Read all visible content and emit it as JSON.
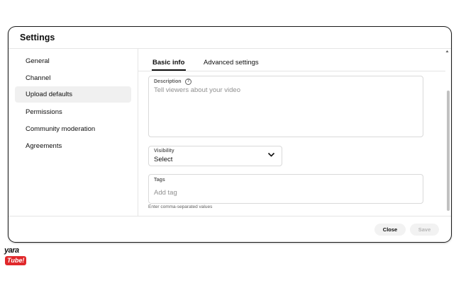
{
  "dialog": {
    "title": "Settings",
    "sidebar": {
      "items": [
        {
          "label": "General"
        },
        {
          "label": "Channel"
        },
        {
          "label": "Upload defaults",
          "active": true
        },
        {
          "label": "Permissions"
        },
        {
          "label": "Community moderation"
        },
        {
          "label": "Agreements"
        }
      ]
    },
    "tabs": [
      {
        "label": "Basic info",
        "active": true
      },
      {
        "label": "Advanced settings"
      }
    ],
    "description": {
      "label": "Description",
      "placeholder": "Tell viewers about your video",
      "help_icon": "?"
    },
    "visibility": {
      "label": "Visibility",
      "value": "Select"
    },
    "tags": {
      "label": "Tags",
      "placeholder": "Add tag",
      "hint": "Enter comma-separated values"
    },
    "footer": {
      "close_label": "Close",
      "save_label": "Save"
    }
  },
  "watermark": {
    "line1": "yara",
    "line2": "Tube!"
  },
  "colors": {
    "text": "#0f0f0f",
    "muted": "#606060",
    "active_nav_bg": "#f0f0f0",
    "border": "#d9d9d9",
    "logo_red": "#e0282b"
  }
}
